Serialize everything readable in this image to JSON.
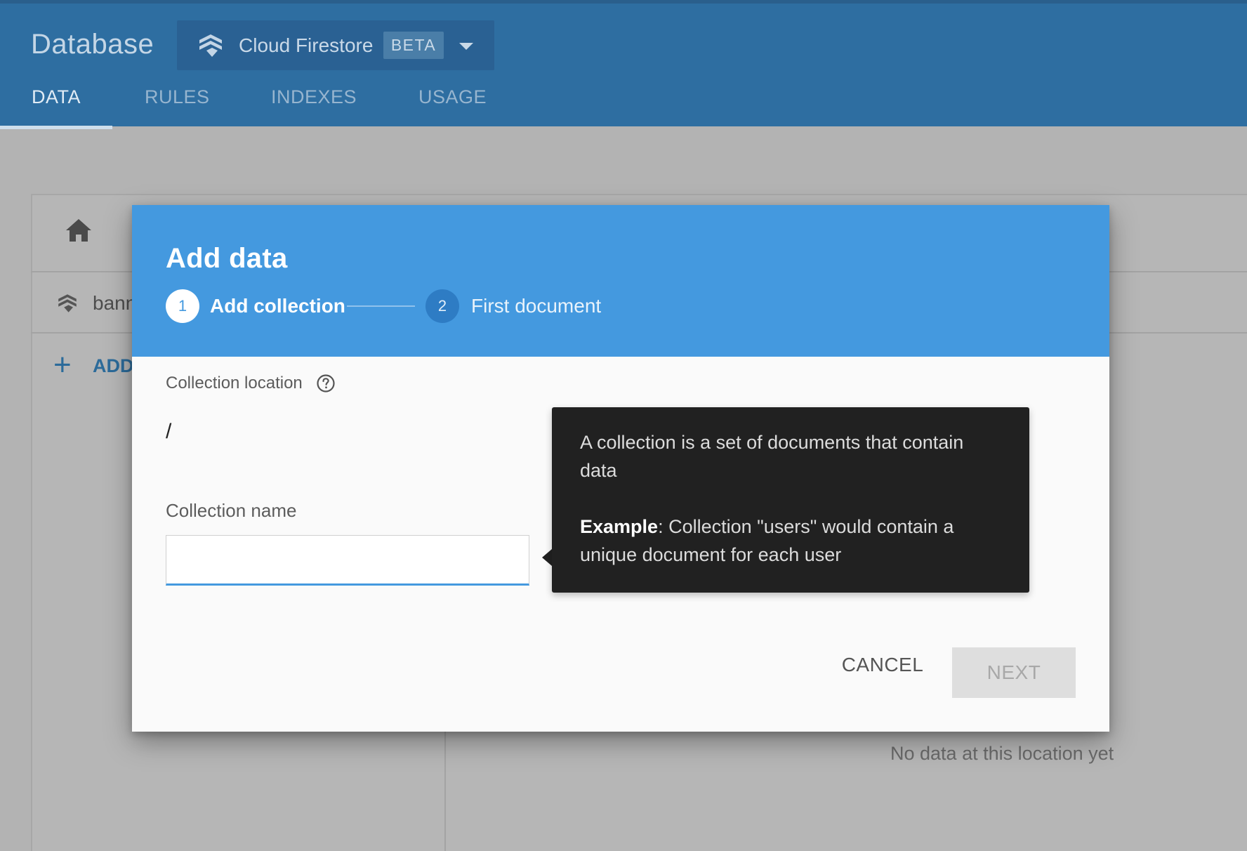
{
  "header": {
    "title": "Database",
    "product": {
      "name": "Cloud Firestore",
      "badge": "BETA",
      "logo_icon": "firestore-icon",
      "dropdown_icon": "chevron-down-icon"
    },
    "tabs": [
      {
        "label": "DATA",
        "active": true
      },
      {
        "label": "RULES",
        "active": false
      },
      {
        "label": "INDEXES",
        "active": false
      },
      {
        "label": "USAGE",
        "active": false
      }
    ]
  },
  "background": {
    "collection_label": "bann",
    "add_label": "ADD",
    "empty_message": "No data at this location yet"
  },
  "dialog": {
    "title": "Add data",
    "steps": [
      {
        "number": "1",
        "label": "Add collection",
        "active": true
      },
      {
        "number": "2",
        "label": "First document",
        "active": false
      }
    ],
    "location_label": "Collection location",
    "location_value": "/",
    "name_label": "Collection name",
    "name_value": "",
    "cancel_label": "CANCEL",
    "next_label": "NEXT"
  },
  "tooltip": {
    "line1": "A collection is a set of documents that contain",
    "line2": "data",
    "example_label": "Example",
    "example_text_1": ": Collection \"users\" would contain a",
    "example_text_2": "unique document for each user"
  },
  "colors": {
    "header_bg": "#2e6ea1",
    "dialog_accent": "#4499df",
    "tooltip_bg": "#212121"
  }
}
